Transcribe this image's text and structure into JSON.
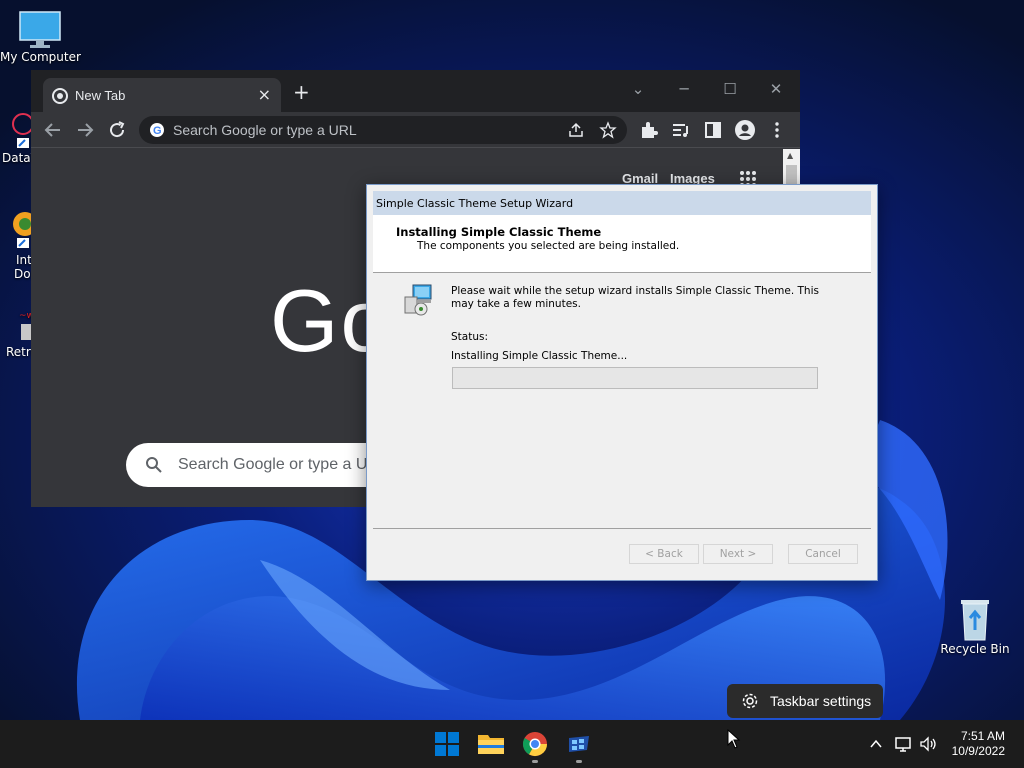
{
  "desktop": {
    "icons": [
      {
        "label": "My Computer",
        "icon": "computer-icon"
      },
      {
        "label": "DataV",
        "icon": "app-shortcut-icon"
      },
      {
        "label": "Int",
        "label2": "Dow",
        "icon": "app-shortcut-icon"
      },
      {
        "label": "Retro",
        "icon": "app-shortcut-icon"
      },
      {
        "label": "Recycle Bin",
        "icon": "recycle-bin-icon"
      }
    ]
  },
  "chrome": {
    "tab_title": "New Tab",
    "omnibox_placeholder": "Search Google or type a URL",
    "top_links": {
      "gmail": "Gmail",
      "images": "Images"
    },
    "logo_text": "Go",
    "search_placeholder": "Search Google or type a URL"
  },
  "wizard": {
    "title": "Simple Classic Theme Setup Wizard",
    "header_title": "Installing Simple Classic Theme",
    "header_subtitle": "The components you selected are being installed.",
    "description": "Please wait while the setup wizard installs Simple Classic Theme. This may take a few minutes.",
    "status_label": "Status:",
    "status_text": "Installing Simple Classic Theme...",
    "progress": 0,
    "buttons": {
      "back": "< Back",
      "next": "Next >",
      "cancel": "Cancel"
    }
  },
  "taskbar": {
    "tooltip": "Taskbar settings",
    "time": "7:51 AM",
    "date": "10/9/2022"
  },
  "colors": {
    "accent": "#0078d4",
    "chrome_dark": "#35363a",
    "taskbar": "#1c1c1c"
  }
}
